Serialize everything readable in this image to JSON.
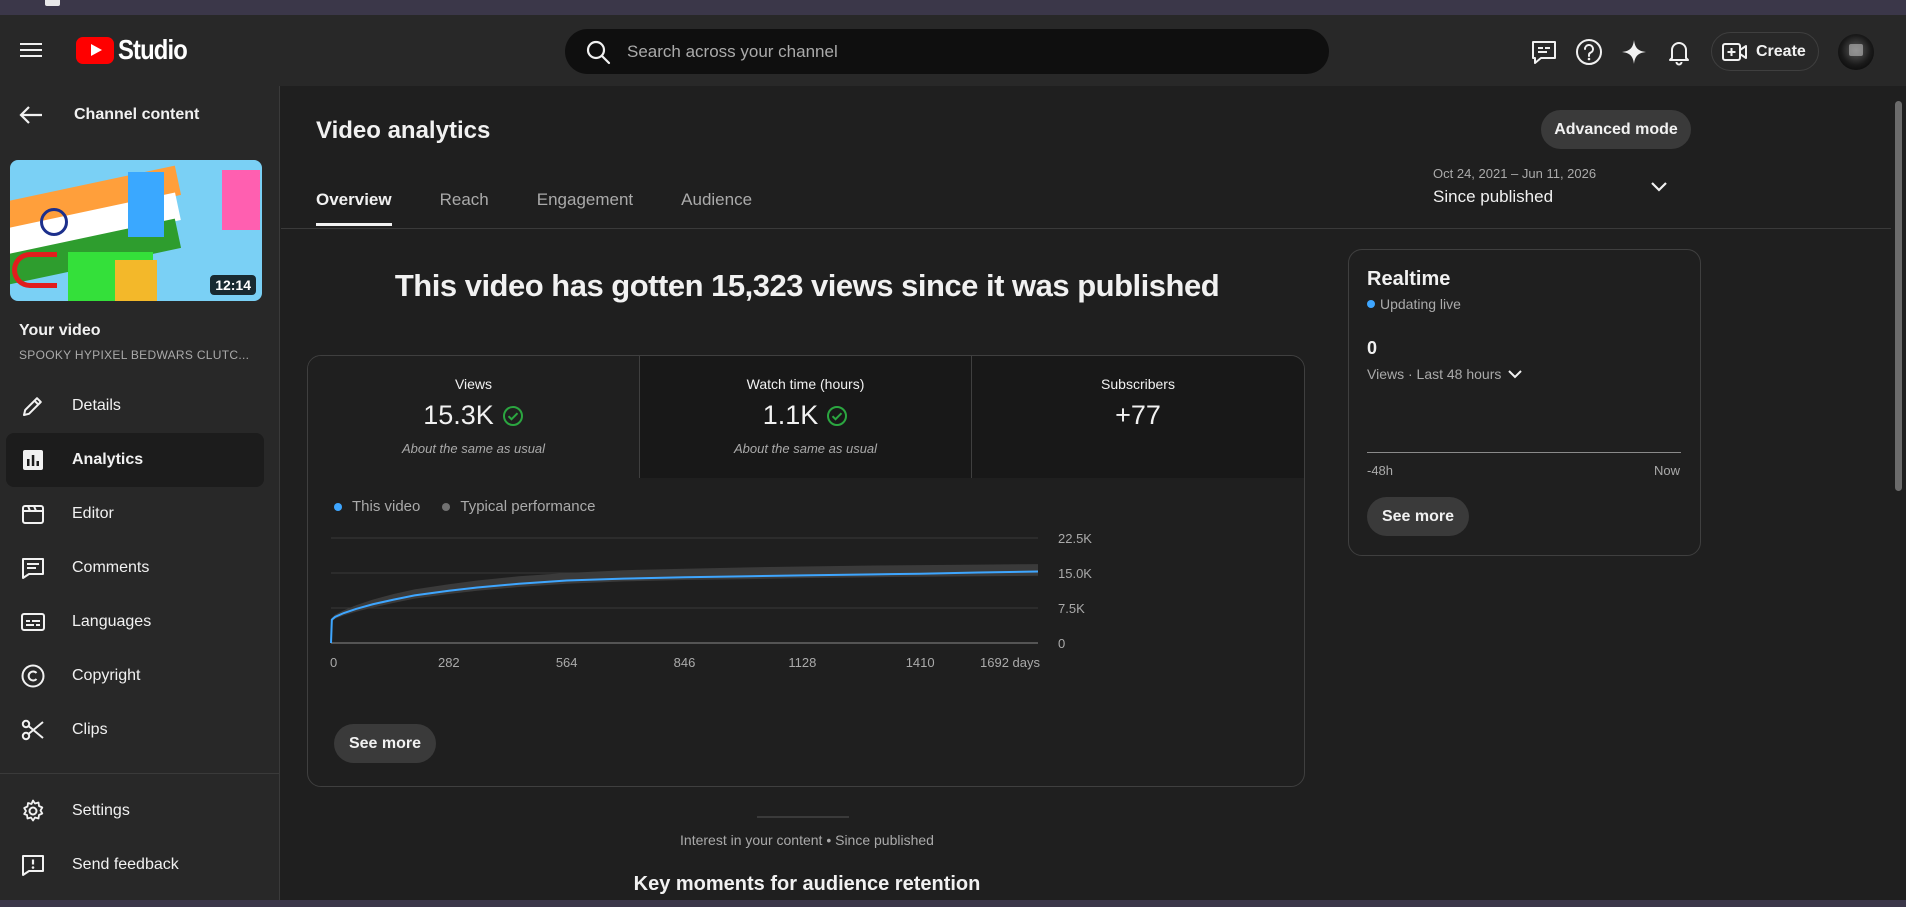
{
  "colors": {
    "accent_blue": "#3ea6ff",
    "check_green": "#2ba640",
    "brand_red": "#ff0000",
    "typical_gray": "#717171"
  },
  "header": {
    "logo_text": "Studio",
    "search": {
      "placeholder": "Search across your channel"
    },
    "icons": [
      "menu-icon",
      "subtitles-icon",
      "help-icon",
      "sparkle-icon",
      "bell-icon"
    ],
    "create_label": "Create"
  },
  "sidebar": {
    "back_label": "Channel content",
    "thumbnail_duration": "12:14",
    "your_video_label": "Your video",
    "video_title": "SPOOKY HYPIXEL BEDWARS CLUTC...",
    "items": [
      {
        "label": "Details",
        "icon": "pencil-icon"
      },
      {
        "label": "Analytics",
        "icon": "analytics-icon"
      },
      {
        "label": "Editor",
        "icon": "clapper-icon"
      },
      {
        "label": "Comments",
        "icon": "comments-icon"
      },
      {
        "label": "Languages",
        "icon": "subtitles-icon"
      },
      {
        "label": "Copyright",
        "icon": "copyright-icon"
      },
      {
        "label": "Clips",
        "icon": "scissors-icon"
      }
    ],
    "bottom_items": [
      {
        "label": "Settings",
        "icon": "gear-icon"
      },
      {
        "label": "Send feedback",
        "icon": "feedback-icon"
      }
    ]
  },
  "main": {
    "title": "Video analytics",
    "advanced_mode_label": "Advanced mode",
    "tabs": [
      {
        "label": "Overview",
        "active": true
      },
      {
        "label": "Reach",
        "active": false
      },
      {
        "label": "Engagement",
        "active": false
      },
      {
        "label": "Audience",
        "active": false
      }
    ],
    "date_range": {
      "dates": "Oct 24, 2021 – Jun 11, 2026",
      "period": "Since published"
    },
    "headline": "This video has gotten 15,323 views since it was published",
    "metrics": [
      {
        "label": "Views",
        "value": "15.3K",
        "note": "About the same as usual"
      },
      {
        "label": "Watch time (hours)",
        "value": "1.1K",
        "note": "About the same as usual"
      },
      {
        "label": "Subscribers",
        "value": "+77",
        "note": ""
      }
    ],
    "see_more_label": "See more",
    "interest_text": "Interest in your content • Since published",
    "key_moments_title": "Key moments for audience retention"
  },
  "realtime": {
    "title": "Realtime",
    "live_label": "Updating live",
    "value": "0",
    "subtitle": "Views · Last 48 hours",
    "axis_left": "-48h",
    "axis_right": "Now",
    "see_more_label": "See more"
  },
  "chart_data": {
    "type": "line",
    "legend": [
      "This video",
      "Typical performance"
    ],
    "x_ticks": [
      0,
      282,
      564,
      846,
      1128,
      1410
    ],
    "x_tick_labels": [
      "0",
      "282",
      "564",
      "846",
      "1128",
      "1410",
      "1692 days"
    ],
    "xlim": [
      0,
      1692
    ],
    "y_ticks": [
      0,
      7500,
      15000,
      22500
    ],
    "y_tick_labels": [
      "0",
      "7.5K",
      "15.0K",
      "22.5K"
    ],
    "ylim": [
      0,
      22500
    ],
    "series": [
      {
        "name": "This video",
        "x": [
          0,
          2,
          10,
          30,
          60,
          100,
          150,
          200,
          282,
          350,
          450,
          564,
          700,
          846,
          1000,
          1128,
          1300,
          1410,
          1550,
          1692
        ],
        "values": [
          0,
          5000,
          5600,
          6400,
          7300,
          8300,
          9300,
          10200,
          11200,
          11900,
          12700,
          13400,
          13800,
          14100,
          14300,
          14500,
          14700,
          14850,
          15100,
          15323
        ]
      },
      {
        "name": "Typical performance",
        "x": [
          0,
          2,
          10,
          30,
          60,
          100,
          150,
          200,
          282,
          350,
          450,
          564,
          700,
          846,
          1000,
          1128,
          1300,
          1410,
          1550,
          1692
        ],
        "low": [
          0,
          4600,
          5200,
          5900,
          6700,
          7600,
          8600,
          9500,
          10500,
          11200,
          12000,
          12700,
          13200,
          13500,
          13700,
          13900,
          14100,
          14200,
          14300,
          14400
        ],
        "high": [
          0,
          5400,
          6100,
          7000,
          8100,
          9300,
          10500,
          11500,
          12600,
          13400,
          14300,
          15000,
          15600,
          15900,
          16200,
          16400,
          16600,
          16700,
          16800,
          16900
        ]
      }
    ],
    "grid": true
  }
}
